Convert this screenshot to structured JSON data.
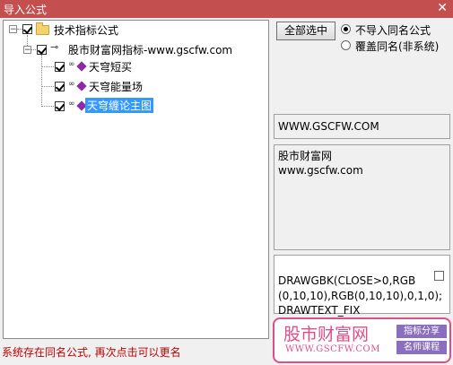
{
  "window": {
    "title": "导入公式",
    "close_glyph": "✕"
  },
  "tree": {
    "root": {
      "label": "技术指标公式",
      "expander": "−"
    },
    "group": {
      "label": "股市财富网指标-www.gscfw.com",
      "expander": "−"
    },
    "items": [
      {
        "label": "天穹短买",
        "selected": false
      },
      {
        "label": "天穹能量场",
        "selected": false
      },
      {
        "label": "天穹缠论主图",
        "selected": true
      }
    ]
  },
  "controls": {
    "select_all_label": "全部选中",
    "radio_options": [
      {
        "label": "不导入同名公式",
        "checked": true
      },
      {
        "label": "覆盖同名(非系统)",
        "checked": false
      }
    ]
  },
  "info": {
    "website": "WWW.GSCFW.COM",
    "description_line1": "股市财富网",
    "description_line2": "www.gscfw.com",
    "code_line1": "DRAWGBK(CLOSE>0,RGB",
    "code_line2": "(0,10,10),RGB(0,10,10),0,1,0);",
    "code_line3": "DRAWTEXT_FIX"
  },
  "status": {
    "message": "系统存在同名公式, 再次点击可以更名"
  },
  "watermark": {
    "brand": "股市财富网",
    "url": "WWW.GSCFW.COM",
    "badge1": "指标分享",
    "badge2": "名师课程"
  },
  "colors": {
    "titlebar": "#c3504f",
    "selection": "#3399ff",
    "status": "#c00000",
    "watermark": "#e04e8a"
  }
}
